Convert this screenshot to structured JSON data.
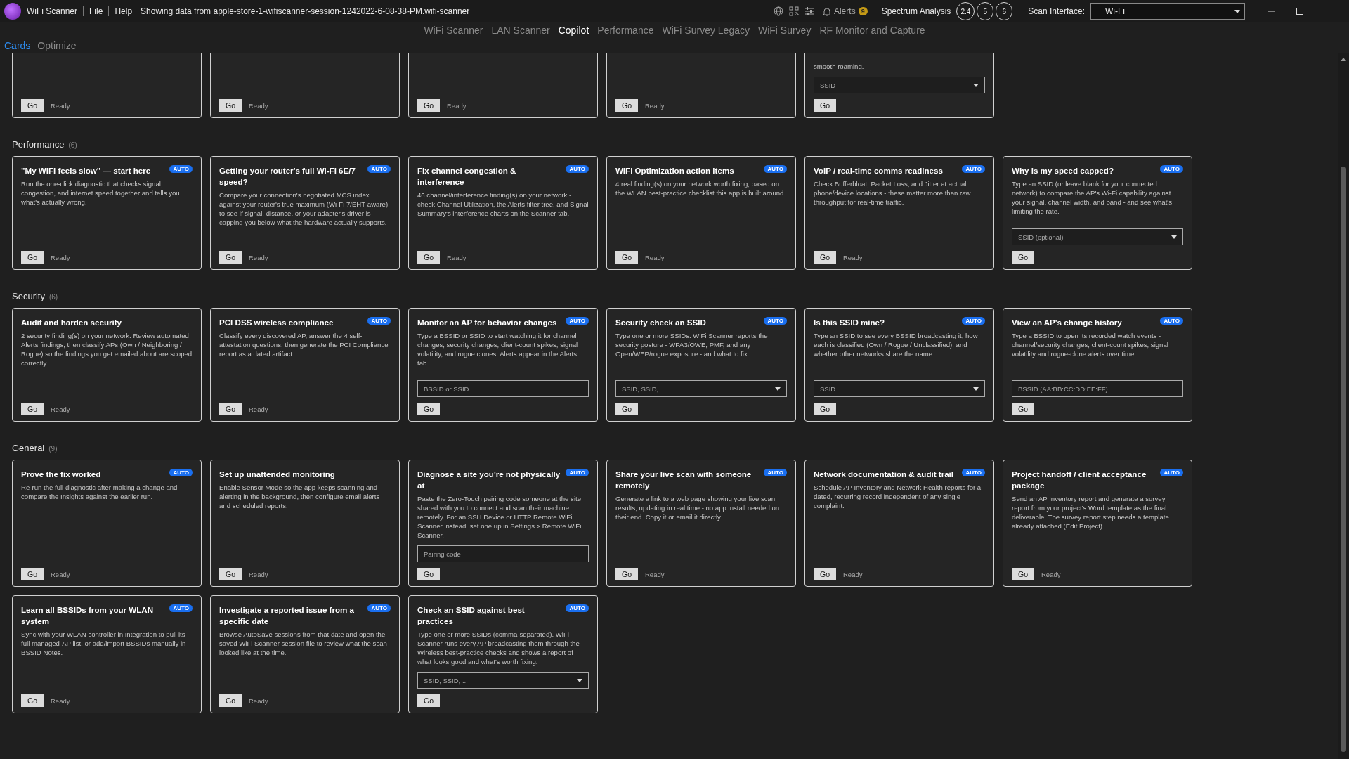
{
  "title_bar": {
    "app_name": "WiFi Scanner",
    "menu": [
      "File",
      "Help"
    ],
    "session_text": "Showing data from apple-store-1-wifiscanner-session-1242022-6-08-38-PM.wifi-scanner",
    "alerts_label": "Alerts",
    "alerts_count": "9",
    "spectrum_label": "Spectrum Analysis",
    "bands": [
      {
        "label": "2.4",
        "selected": true
      },
      {
        "label": "5",
        "selected": true
      },
      {
        "label": "6",
        "selected": true
      }
    ],
    "interface_label": "Scan Interface:",
    "interface_value": "Wi-Fi"
  },
  "nav_tabs": [
    {
      "label": "WiFi Scanner",
      "selected": false
    },
    {
      "label": "LAN Scanner",
      "selected": false
    },
    {
      "label": "Copilot",
      "selected": true
    },
    {
      "label": "Performance",
      "selected": false
    },
    {
      "label": "WiFi Survey Legacy",
      "selected": false
    },
    {
      "label": "WiFi Survey",
      "selected": false
    },
    {
      "label": "RF Monitor and Capture",
      "selected": false
    }
  ],
  "sub_tabs": [
    {
      "label": "Cards",
      "selected": true
    },
    {
      "label": "Optimize",
      "selected": false
    }
  ],
  "partial_cards": [
    {
      "button": "Go",
      "status": "Ready"
    },
    {
      "button": "Go",
      "status": "Ready"
    },
    {
      "button": "Go",
      "status": "Ready"
    },
    {
      "button": "Go",
      "status": "Ready"
    },
    {
      "description": "smooth roaming.",
      "input": {
        "kind": "select",
        "placeholder": "SSID"
      },
      "button": "Go"
    }
  ],
  "sections": [
    {
      "title": "Performance",
      "count": "(6)",
      "cards": [
        {
          "title": "\"My WiFi feels slow\" — start here",
          "auto": true,
          "badge": "AUTO",
          "description": "Run the one-click diagnostic that checks signal, congestion, and internet speed together and tells you what's actually wrong.",
          "button": "Go",
          "status": "Ready"
        },
        {
          "title": "Getting your router's full Wi-Fi 6E/7 speed?",
          "auto": true,
          "badge": "AUTO",
          "description": "Compare your connection's negotiated MCS index against your router's true maximum (Wi-Fi 7/EHT-aware) to see if signal, distance, or your adapter's driver is capping you below what the hardware actually supports.",
          "button": "Go",
          "status": "Ready"
        },
        {
          "title": "Fix channel congestion & interference",
          "auto": true,
          "badge": "AUTO",
          "description": "46 channel/interference finding(s) on your network - check Channel Utilization, the Alerts filter tree, and Signal Summary's interference charts on the Scanner tab.",
          "button": "Go",
          "status": "Ready"
        },
        {
          "title": "WiFi Optimization action items",
          "auto": true,
          "badge": "AUTO",
          "description": "4 real finding(s) on your network worth fixing, based on the WLAN best-practice checklist this app is built around.",
          "button": "Go",
          "status": "Ready"
        },
        {
          "title": "VoIP / real-time comms readiness",
          "auto": true,
          "badge": "AUTO",
          "description": "Check Bufferbloat, Packet Loss, and Jitter at actual phone/device locations - these matter more than raw throughput for real-time traffic.",
          "button": "Go",
          "status": "Ready"
        },
        {
          "title": "Why is my speed capped?",
          "auto": true,
          "badge": "AUTO",
          "description": "Type an SSID (or leave blank for your connected network) to compare the AP's Wi-Fi capability against your signal, channel width, and band - and see what's limiting the rate.",
          "input": {
            "kind": "select",
            "placeholder": "SSID (optional)"
          },
          "button": "Go"
        }
      ]
    },
    {
      "title": "Security",
      "count": "(6)",
      "cards": [
        {
          "title": "Audit and harden security",
          "auto": false,
          "description": "2 security finding(s) on your network. Review automated Alerts findings, then classify APs (Own / Neighboring / Rogue) so the findings you get emailed about are scoped correctly.",
          "button": "Go",
          "status": "Ready"
        },
        {
          "title": "PCI DSS wireless compliance",
          "auto": true,
          "badge": "AUTO",
          "description": "Classify every discovered AP, answer the 4 self-attestation questions, then generate the PCI Compliance report as a dated artifact.",
          "button": "Go",
          "status": "Ready"
        },
        {
          "title": "Monitor an AP for behavior changes",
          "auto": true,
          "badge": "AUTO",
          "description": "Type a BSSID or SSID to start watching it for channel changes, security changes, client-count spikes, signal volatility, and rogue clones. Alerts appear in the Alerts tab.",
          "input": {
            "kind": "text",
            "placeholder": "BSSID or SSID"
          },
          "button": "Go"
        },
        {
          "title": "Security check an SSID",
          "auto": true,
          "badge": "AUTO",
          "description": "Type one or more SSIDs. WiFi Scanner reports the security posture - WPA3/OWE, PMF, and any Open/WEP/rogue exposure - and what to fix.",
          "input": {
            "kind": "select",
            "placeholder": "SSID, SSID, ..."
          },
          "button": "Go"
        },
        {
          "title": "Is this SSID mine?",
          "auto": true,
          "badge": "AUTO",
          "description": "Type an SSID to see every BSSID broadcasting it, how each is classified (Own / Rogue / Unclassified), and whether other networks share the name.",
          "input": {
            "kind": "select",
            "placeholder": "SSID"
          },
          "button": "Go"
        },
        {
          "title": "View an AP's change history",
          "auto": true,
          "badge": "AUTO",
          "description": "Type a BSSID to open its recorded watch events - channel/security changes, client-count spikes, signal volatility and rogue-clone alerts over time.",
          "input": {
            "kind": "text",
            "placeholder": "BSSID (AA:BB:CC:DD:EE:FF)"
          },
          "button": "Go"
        }
      ]
    },
    {
      "title": "General",
      "count": "(9)",
      "cards": [
        {
          "title": "Prove the fix worked",
          "auto": true,
          "badge": "AUTO",
          "description": "Re-run the full diagnostic after making a change and compare the Insights against the earlier run.",
          "button": "Go",
          "status": "Ready"
        },
        {
          "title": "Set up unattended monitoring",
          "auto": false,
          "description": "Enable Sensor Mode so the app keeps scanning and alerting in the background, then configure email alerts and scheduled reports.",
          "button": "Go",
          "status": "Ready"
        },
        {
          "title": "Diagnose a site you're not physically at",
          "auto": true,
          "badge": "AUTO",
          "description": "Paste the Zero-Touch pairing code someone at the site shared with you to connect and scan their machine remotely. For an SSH Device or HTTP Remote WiFi Scanner instead, set one up in Settings > Remote WiFi Scanner.",
          "input": {
            "kind": "text",
            "placeholder": "Pairing code"
          },
          "button": "Go"
        },
        {
          "title": "Share your live scan with someone remotely",
          "auto": true,
          "badge": "AUTO",
          "description": "Generate a link to a web page showing your live scan results, updating in real time - no app install needed on their end. Copy it or email it directly.",
          "button": "Go",
          "status": "Ready"
        },
        {
          "title": "Network documentation & audit trail",
          "auto": true,
          "badge": "AUTO",
          "description": "Schedule AP Inventory and Network Health reports for a dated, recurring record independent of any single complaint.",
          "button": "Go",
          "status": "Ready"
        },
        {
          "title": "Project handoff / client acceptance package",
          "auto": true,
          "badge": "AUTO",
          "description": "Send an AP Inventory report and generate a survey report from your project's Word template as the final deliverable. The survey report step needs a template already attached (Edit Project).",
          "button": "Go",
          "status": "Ready"
        },
        {
          "title": "Learn all BSSIDs from your WLAN system",
          "auto": true,
          "badge": "AUTO",
          "description": "Sync with your WLAN controller in Integration to pull its full managed-AP list, or add/import BSSIDs manually in BSSID Notes.",
          "button": "Go",
          "status": "Ready"
        },
        {
          "title": "Investigate a reported issue from a specific date",
          "auto": true,
          "badge": "AUTO",
          "description": "Browse AutoSave sessions from that date and open the saved WiFi Scanner session file to review what the scan looked like at the time.",
          "button": "Go",
          "status": "Ready"
        },
        {
          "title": "Check an SSID against best practices",
          "auto": true,
          "badge": "AUTO",
          "description": "Type one or more SSIDs (comma-separated). WiFi Scanner runs every AP broadcasting them through the Wireless best-practice checks and shows a report of what looks good and what's worth fixing.",
          "input": {
            "kind": "select",
            "placeholder": "SSID, SSID, ..."
          },
          "button": "Go"
        }
      ]
    }
  ]
}
